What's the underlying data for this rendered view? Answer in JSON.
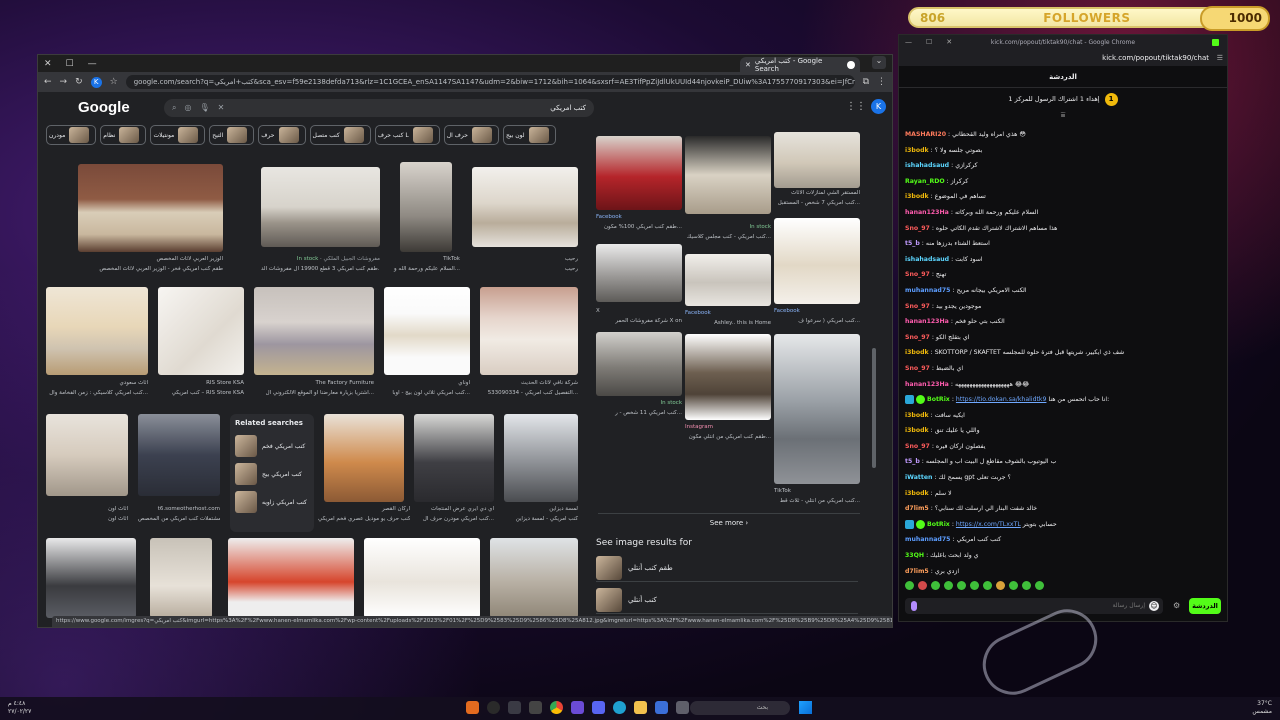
{
  "overlay": {
    "followers_count": "806",
    "followers_label": "FOLLOWERS",
    "followers_goal": "1000"
  },
  "browser": {
    "tab_title": "كتب امريكي - Google Search",
    "url": "google.com/search?q=كتب+امريكي&sca_esv=f59e2138defda713&rlz=1C1GCEA_enSA1147SA1147&udm=2&biw=1712&bih=1064&sxsrf=AE3TifPpZiJdlUkUUId44njovkeiP_DUiw%3A1755770917303&ei=JfCmaPOoEtSIkdUP6f...",
    "status_url": "https://www.google.com/imgres?q=كتب امريكي&imgurl=https%3A%2F%2Fwww.hanen-elmamlika.com%2Fwp-content%2Fuploads%2F2023%2F01%2F%25D9%2583%25D9%2586%25D8%25A812.jpg&imgrefurl=https%3A%2F%2Fwww.hanen-elmamlika.com%2F%25D8%25B9%25D8%25A4%25D9%2581%25D8%25B5%25D8%25B5..."
  },
  "google": {
    "logo": "Google",
    "query": "كتب امريكي",
    "avatar_letter": "K",
    "chips": [
      "مودرن",
      "نظام",
      "مونتيلات",
      "التيح",
      "حرف",
      "كنب متصل",
      "كنب حرف L",
      "حرف ال",
      "لون بيج"
    ]
  },
  "results": {
    "row1": [
      {
        "src": "الوزير العربي لاثاث المخصص",
        "title": "طقم كنب امريكي فخر - الوزير العربي لاثاث المخصص"
      },
      {
        "src": "مفروشات الجبيل الملكي",
        "stock": "In stock",
        "title": "طقم كنب امريكي 3 قطع 19900 ال مفروشات الد..."
      },
      {
        "src": "TikTok",
        "title": "السلام عليكم ورحمة الله و..."
      },
      {
        "src": "رحيب",
        "title": "رحيب"
      }
    ],
    "row2": [
      {
        "src": "أثاث سعودي",
        "title": "كنب امريكي كلاسيكي : زمن الفخامة وال..."
      },
      {
        "src": "RIS Store KSA",
        "title": "كنب امريكي – RIS Store KSA"
      },
      {
        "src": "The Factory Furniture",
        "title": "اشتريا بزيارة معارضنا او الموقع الالكتروني ال..."
      },
      {
        "src": "اوناي",
        "title": "كنب امريكي ثلاثي لون بيج - أوبا..."
      },
      {
        "src": "شركة نافي لاثاث الحديث",
        "title": "التفصيل كنب امريكي - 533090334..."
      }
    ],
    "row3": [
      {
        "src": "أثاث اون",
        "title": "أثاث اون"
      },
      {
        "src": "t6.someotherhost.com",
        "title": "مشتملات كنب امريكي من المخصص..."
      },
      {
        "src": "أركان القصر",
        "title": "كنب حرف يو موديل عصري فخم امريكي..."
      },
      {
        "src": "آي دي ايري عرض المنتجات",
        "title": "كنب امريكي مودرن حرف ال..."
      },
      {
        "src": "لمسة ديزاين",
        "title": "كنب امريكي - لمسة ديزاين"
      }
    ],
    "related": {
      "heading": "Related searches",
      "items": [
        "كنب امريكي فخم",
        "كنب امريكي بيج",
        "كنب امريكي زاويه"
      ]
    }
  },
  "panel": {
    "close": "×",
    "tiles": [
      {
        "src": "Facebook",
        "title": "طقم كنب امريكي 100% مكون..."
      },
      {
        "src": "In stock",
        "title": "كنب امريكي - كنب مجلس كلاسيك..."
      },
      {
        "src": "المستقر الشي لمنازلات الأثاث",
        "title": "كنب امريكي 7 شخص - المستقبل..."
      },
      {
        "src": "شركة مفروشات الحمر X",
        "title": "شركة مفروشات الحمر X on"
      },
      {
        "src": "Facebook",
        "title": "Ashley.. this is Home"
      },
      {
        "src": "Facebook",
        "title": "كنب امريكي ( سرعوا ف..."
      },
      {
        "src": "In stock",
        "title": "كنب امريكي 11 شخص - ر..."
      },
      {
        "src": "Instagram",
        "title": "طقم كنب امريكي من انتلي مكون..."
      },
      {
        "src": "TikTok",
        "title": "كنب امريكي من أنتلي - ثلاث قط..."
      }
    ],
    "see_more": "See more",
    "see_image_results": "See image results for",
    "image_results": [
      "طقم كنب أنتلي",
      "كنب أنتلي"
    ]
  },
  "chat": {
    "window_title": "kick.com/popout/tiktak90/chat - Google Chrome",
    "url": "kick.com/popout/tiktak90/chat",
    "header": "الدردشة",
    "pinned_badge": "1",
    "pinned_text": "إهداء 1 اشتراك الرسول للمركز 1",
    "messages": [
      {
        "user": "MASHARI20",
        "color": "#ff7b5c",
        "text": "هذي امراه وليد القحطاني 😳"
      },
      {
        "user": "i3bodk",
        "color": "#f0b90b",
        "text": "بصوتي جلسه ولا ؟"
      },
      {
        "user": "ishahadsaud",
        "color": "#5cd6ff",
        "text": "كركرازي"
      },
      {
        "user": "Rayan_RDO",
        "color": "#53fc18",
        "text": "كركراز"
      },
      {
        "user": "i3bodk",
        "color": "#f0b90b",
        "text": "تساهم في الموضوع"
      },
      {
        "user": "hanan123Ha",
        "color": "#ff5cae",
        "text": "السلام عليكم ورحمة الله وبركاته"
      },
      {
        "user": "Sno_97",
        "color": "#ff5c5c",
        "text": "هذا مساهم الاشتراك لاشتراك تقدم الكاتي حلوه"
      },
      {
        "user": "t5_b",
        "color": "#c19bff",
        "text": "استعط الشتاء بدرزها منه"
      },
      {
        "user": "ishahadsaud",
        "color": "#5cd6ff",
        "text": "اسود كابت"
      },
      {
        "user": "Sno_97",
        "color": "#ff5c5c",
        "text": "تهنج"
      },
      {
        "user": "muhannad75",
        "color": "#5c9dff",
        "text": "الكنب الامريكي بيجانه مريح"
      },
      {
        "user": "Sno_97",
        "color": "#ff5c5c",
        "text": "موجودين يجدو بيد"
      },
      {
        "user": "hanan123Ha",
        "color": "#ff5cae",
        "text": "الكنب بتي حلو فخم"
      },
      {
        "user": "Sno_97",
        "color": "#ff5c5c",
        "text": "اي بتقلج الكو"
      },
      {
        "user": "i3bodk",
        "color": "#f0b90b",
        "text": "SKOTTORP / SKAFTET شف ذي ايكيير، شريتها قبل فترة حلوه للمجلسه"
      },
      {
        "user": "Sno_97",
        "color": "#ff5c5c",
        "text": "اي بالضبط"
      },
      {
        "user": "hanan123Ha",
        "color": "#ff5cae",
        "text": "هههههههههههههههههههه 😂😂"
      },
      {
        "user": "BotRix",
        "color": "#53fc18",
        "text": "انا حاب اتحمس من هنا:",
        "link": "https://tio.dokan.sa/khalidtk9"
      },
      {
        "user": "i3bodk",
        "color": "#f0b90b",
        "text": "ايكيه سافت"
      },
      {
        "user": "i3bodk",
        "color": "#f0b90b",
        "text": "واللي يا عليك تنق"
      },
      {
        "user": "Sno_97",
        "color": "#ff5c5c",
        "text": "يفصلون اركان فيره"
      },
      {
        "user": "t5_b",
        "color": "#c19bff",
        "text": "ب اليوتيوب بالشوف مقاطع ل البيت اب و المجلسه"
      },
      {
        "user": "iWatten",
        "color": "#5cd6ff",
        "text": "يسمح لك gpt ؟ جربت تعلى"
      },
      {
        "user": "i3bodk",
        "color": "#f0b90b",
        "text": "لا سلم"
      },
      {
        "user": "d7lim5",
        "color": "#ff9f5c",
        "text": "خالد شفت البنار الي ارسلت لك سنابي؟"
      },
      {
        "user": "BotRix",
        "color": "#53fc18",
        "text": "حسابي بتويتر",
        "link": "https://x.com/TLxxTL"
      },
      {
        "user": "muhannad75",
        "color": "#5c9dff",
        "text": "كنب كنب امريكي"
      },
      {
        "user": "33QH",
        "color": "#53fc18",
        "text": "ي ولد ابحث باغليك"
      },
      {
        "user": "d7lim5",
        "color": "#ff9f5c",
        "text": "ازدي بري"
      }
    ],
    "input_placeholder": "إرسال رسالة",
    "send_label": "الدردشة"
  },
  "taskbar": {
    "time": "٤:٤٨ م",
    "date": "٢٧/٠٢/٢٧",
    "search_placeholder": "بحث",
    "weather_temp": "37°C",
    "weather_desc": "مشمس"
  }
}
